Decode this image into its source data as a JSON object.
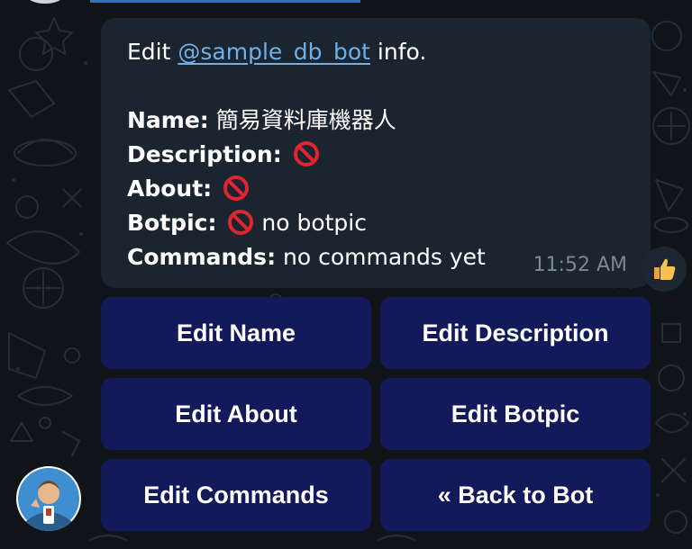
{
  "message": {
    "intro_prefix": "Edit ",
    "bot_handle": "@sample_db_bot",
    "intro_suffix": " info.",
    "name_label": "Name:",
    "name_value": "簡易資料庫機器人",
    "description_label": "Description:",
    "about_label": "About:",
    "botpic_label": "Botpic:",
    "botpic_value": "no botpic",
    "commands_label": "Commands:",
    "commands_value": "no commands yet",
    "time": "11:52 AM"
  },
  "reaction": {
    "icon": "thumbs-up-icon"
  },
  "keyboard": {
    "buttons": [
      {
        "label": "Edit Name"
      },
      {
        "label": "Edit Description"
      },
      {
        "label": "Edit About"
      },
      {
        "label": "Edit Botpic"
      },
      {
        "label": "Edit Commands"
      },
      {
        "label": "« Back to Bot"
      }
    ]
  },
  "colors": {
    "bubble": "#1b252f",
    "link": "#6fb0ea",
    "button": "#13195a",
    "prohibited": "#e0252f"
  }
}
